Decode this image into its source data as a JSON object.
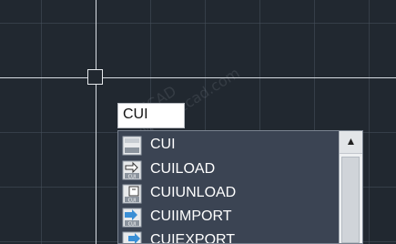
{
  "watermark": {
    "text": "乐享CAD  www.zzzcad.com"
  },
  "command_line": {
    "typed": "CUI"
  },
  "autocomplete": {
    "items": [
      {
        "label": "CUI",
        "icon": "cui-icon"
      },
      {
        "label": "CUILOAD",
        "icon": "cuiload-icon"
      },
      {
        "label": "CUIUNLOAD",
        "icon": "cuiunload-icon"
      },
      {
        "label": "CUIIMPORT",
        "icon": "cuiimport-icon"
      },
      {
        "label": "CUIEXPORT",
        "icon": "cuiexport-icon"
      }
    ],
    "scroll_up_glyph": "▲",
    "icon_tag": "CUI"
  },
  "colors": {
    "canvas_bg": "#212830",
    "crosshair": "#d8dde3",
    "list_bg": "#3b4453",
    "icon_accent": "#3a8fd6"
  }
}
